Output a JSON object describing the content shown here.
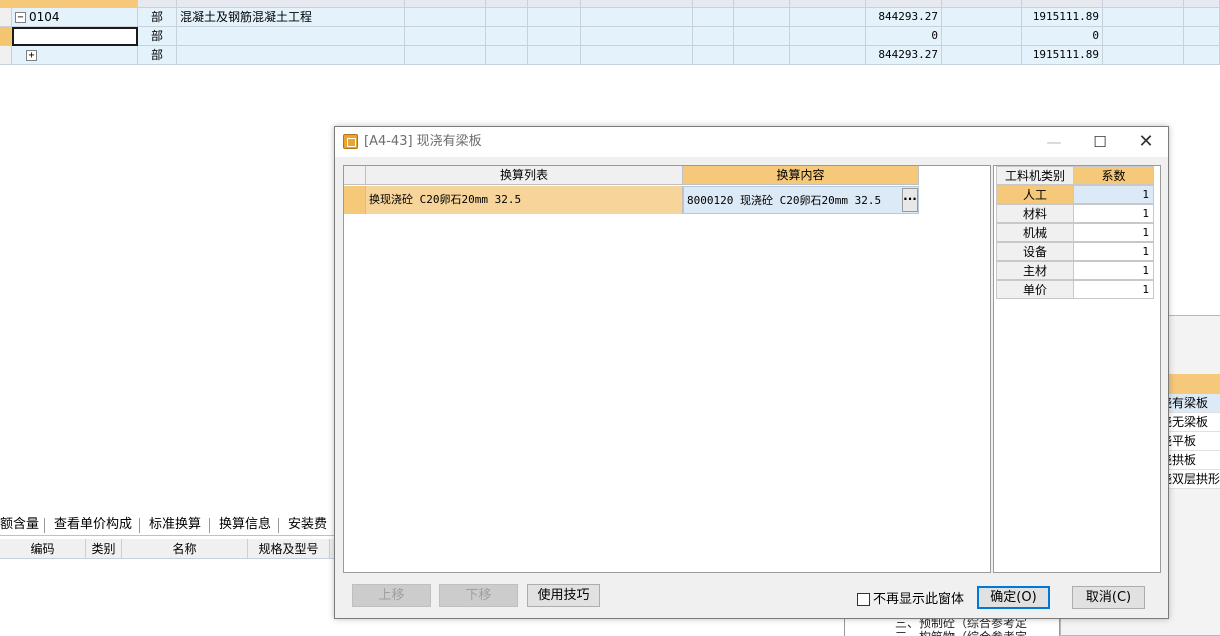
{
  "grid": {
    "rows": [
      {
        "code": "0104",
        "expander": "−",
        "type": "部",
        "name": "混凝土及钢筋混凝土工程",
        "total1": "844293.27",
        "total2": "1915111.89"
      },
      {
        "code": "",
        "expander": "",
        "type": "部",
        "name": "",
        "total1": "0",
        "total2": "0"
      },
      {
        "code": "",
        "expander": "+",
        "type": "部",
        "name": "",
        "total1": "844293.27",
        "total2": "1915111.89"
      }
    ]
  },
  "bottom_tabs": [
    "额含量",
    "查看单价构成",
    "标准换算",
    "换算信息",
    "安装费用"
  ],
  "sub_headers": [
    "编码",
    "类别",
    "名称",
    "规格及型号"
  ],
  "back_window": {
    "items": [
      "浇有梁板",
      "浇无梁板",
      "浇平板",
      "浇拱板",
      "浇双层拱形"
    ],
    "tree_lines": [
      "三、预制砼（综合参考定",
      "三、构筑物（综合参考定"
    ]
  },
  "dialog": {
    "title": "[A4-43]  现浇有梁板",
    "window_controls": {
      "minimize": "—",
      "maximize": "☐",
      "close": "✕"
    },
    "conversion": {
      "col_list": "换算列表",
      "col_content": "换算内容",
      "row": {
        "list": "换现浇砼 C20卵石20mm 32.5",
        "content": "8000120  现浇砼 C20卵石20mm 32.5",
        "ellipsis": "···"
      }
    },
    "coefficients": {
      "col_category": "工料机类别",
      "col_factor": "系数",
      "rows": [
        {
          "category": "人工",
          "factor": "1"
        },
        {
          "category": "材料",
          "factor": "1"
        },
        {
          "category": "机械",
          "factor": "1"
        },
        {
          "category": "设备",
          "factor": "1"
        },
        {
          "category": "主材",
          "factor": "1"
        },
        {
          "category": "单价",
          "factor": "1"
        }
      ]
    },
    "buttons": {
      "up": "上移",
      "down": "下移",
      "tips": "使用技巧",
      "ok": "确定(O)",
      "cancel": "取消(C)"
    },
    "checkbox_label": "不再显示此窗体"
  },
  "colors": {
    "header_selected": "#f6c87a",
    "row_blue": "#e4f2fc",
    "primary_border": "#0078d7"
  }
}
